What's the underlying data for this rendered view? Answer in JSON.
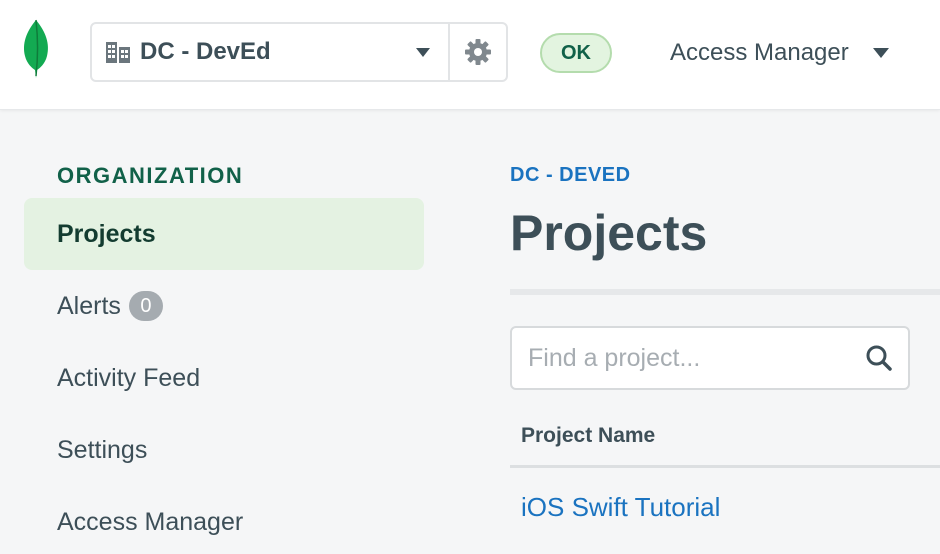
{
  "header": {
    "org_name": "DC - DevEd",
    "status": "OK",
    "access_manager_label": "Access Manager"
  },
  "sidebar": {
    "section_title": "ORGANIZATION",
    "items": [
      {
        "label": "Projects",
        "active": true
      },
      {
        "label": "Alerts",
        "badge": "0"
      },
      {
        "label": "Activity Feed"
      },
      {
        "label": "Settings"
      },
      {
        "label": "Access Manager"
      }
    ]
  },
  "main": {
    "breadcrumb": "DC - DEVED",
    "title": "Projects",
    "search": {
      "placeholder": "Find a project..."
    },
    "table": {
      "columns": [
        "Project Name"
      ],
      "rows": [
        {
          "name": "iOS Swift Tutorial"
        }
      ]
    }
  },
  "colors": {
    "brand_green": "#13aa52",
    "accent_blue": "#1a73c0",
    "active_bg": "#e4f2e2"
  },
  "icons": [
    "mongodb-leaf-icon",
    "building-icon",
    "chevron-down-icon",
    "gear-icon",
    "search-icon"
  ]
}
